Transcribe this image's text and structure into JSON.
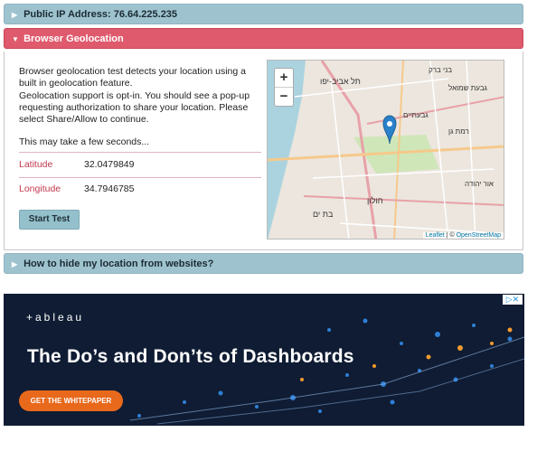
{
  "sections": {
    "public_ip": {
      "label": "Public IP Address: 76.64.225.235"
    },
    "geo": {
      "label": "Browser Geolocation"
    },
    "hide": {
      "label": "How to hide my location from websites?"
    }
  },
  "geo_panel": {
    "para1": "Browser geolocation test detects your location using a built in geolocation feature.",
    "para2": "Geolocation support is opt-in. You should see a pop-up requesting authorization to share your location. Please select Share/Allow to continue.",
    "para3": "This may take a few seconds...",
    "latitude_label": "Latitude",
    "latitude_value": "32.0479849",
    "longitude_label": "Longitude",
    "longitude_value": "34.7946785",
    "start_button": "Start Test"
  },
  "map": {
    "zoom_in": "+",
    "zoom_out": "−",
    "attribution_leaflet": "Leaflet",
    "attribution_sep": " | © ",
    "attribution_osm": "OpenStreetMap",
    "labels": [
      "בני ברק",
      "תל אביב-יפו",
      "גבעתיים",
      "רמת גן",
      "חולון",
      "בת ים",
      "אור יהודה",
      "גבעת שמואל"
    ]
  },
  "ad": {
    "brand": "+ableau",
    "title": "The Do’s and Don’ts of Dashboards",
    "cta": "GET THE WHITEPAPER",
    "choices": "▷✕"
  },
  "colors": {
    "bar": "#9ec3cf",
    "active_bar": "#e05a6d",
    "ad_bg": "#0f1c33",
    "cta": "#e8691c"
  }
}
